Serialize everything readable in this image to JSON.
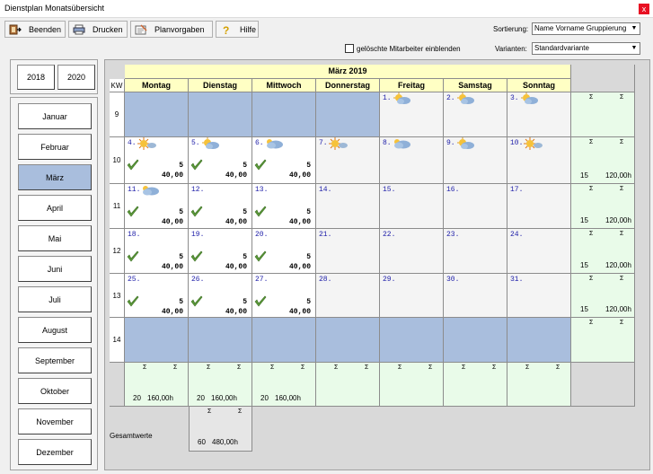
{
  "window": {
    "title": "Dienstplan Monatsübersicht",
    "close": "x"
  },
  "toolbar": [
    {
      "name": "beenden-button",
      "icon": "exit-icon",
      "label": "Beenden"
    },
    {
      "name": "drucken-button",
      "icon": "print-icon",
      "label": "Drucken"
    },
    {
      "name": "planvorgaben-button",
      "icon": "planvorgaben-icon",
      "label": "Planvorgaben"
    },
    {
      "name": "hilfe-button",
      "icon": "help-icon",
      "label": "Hilfe"
    }
  ],
  "sort": {
    "label": "Sortierung:",
    "value": "Name Vorname Gruppierung"
  },
  "variant": {
    "label": "Varianten:",
    "value": "Standardvariante"
  },
  "deleted_checkbox": {
    "label": "gelöschte Mitarbeiter einblenden",
    "checked": false
  },
  "years": [
    "2018",
    "2020"
  ],
  "months": [
    "Januar",
    "Februar",
    "März",
    "April",
    "Mai",
    "Juni",
    "Juli",
    "August",
    "September",
    "Oktober",
    "November",
    "Dezember"
  ],
  "selected_month": "März",
  "calendar": {
    "title": "März 2019",
    "kw_label": "KW",
    "days": [
      "Montag",
      "Dienstag",
      "Mittwoch",
      "Donnerstag",
      "Freitag",
      "Samstag",
      "Sonntag"
    ],
    "sigma": "Σ",
    "weeks": [
      {
        "kw": "9",
        "cells": [
          {
            "bg": "blue"
          },
          {
            "bg": "blue"
          },
          {
            "bg": "blue"
          },
          {
            "bg": "blue"
          },
          {
            "day": "1.",
            "weather": "sun-cloud",
            "bg": "grey"
          },
          {
            "day": "2.",
            "weather": "sun-cloud",
            "bg": "grey"
          },
          {
            "day": "3.",
            "weather": "sun-cloud",
            "bg": "grey"
          }
        ],
        "sum": {
          "count": "",
          "hours": ""
        }
      },
      {
        "kw": "10",
        "cells": [
          {
            "day": "4.",
            "weather": "sun",
            "check": true,
            "value": "5",
            "hours": "40,00",
            "bg": "white"
          },
          {
            "day": "5.",
            "weather": "sun-cloud",
            "check": true,
            "value": "5",
            "hours": "40,00",
            "bg": "white"
          },
          {
            "day": "6.",
            "weather": "cloud",
            "check": true,
            "value": "5",
            "hours": "40,00",
            "bg": "white"
          },
          {
            "day": "7.",
            "weather": "sun",
            "bg": "grey"
          },
          {
            "day": "8.",
            "weather": "cloud",
            "bg": "grey"
          },
          {
            "day": "9.",
            "weather": "sun-cloud",
            "bg": "grey"
          },
          {
            "day": "10.",
            "weather": "sun",
            "bg": "grey"
          }
        ],
        "sum": {
          "count": "15",
          "hours": "120,00h"
        }
      },
      {
        "kw": "11",
        "cells": [
          {
            "day": "11.",
            "weather": "cloud",
            "check": true,
            "value": "5",
            "hours": "40,00",
            "bg": "white"
          },
          {
            "day": "12.",
            "check": true,
            "value": "5",
            "hours": "40,00",
            "bg": "white"
          },
          {
            "day": "13.",
            "check": true,
            "value": "5",
            "hours": "40,00",
            "bg": "white"
          },
          {
            "day": "14.",
            "bg": "grey"
          },
          {
            "day": "15.",
            "bg": "grey"
          },
          {
            "day": "16.",
            "bg": "grey"
          },
          {
            "day": "17.",
            "bg": "grey"
          }
        ],
        "sum": {
          "count": "15",
          "hours": "120,00h"
        }
      },
      {
        "kw": "12",
        "cells": [
          {
            "day": "18.",
            "check": true,
            "value": "5",
            "hours": "40,00",
            "bg": "white"
          },
          {
            "day": "19.",
            "check": true,
            "value": "5",
            "hours": "40,00",
            "bg": "white"
          },
          {
            "day": "20.",
            "check": true,
            "value": "5",
            "hours": "40,00",
            "bg": "white"
          },
          {
            "day": "21.",
            "bg": "grey"
          },
          {
            "day": "22.",
            "bg": "grey"
          },
          {
            "day": "23.",
            "bg": "grey"
          },
          {
            "day": "24.",
            "bg": "grey"
          }
        ],
        "sum": {
          "count": "15",
          "hours": "120,00h"
        }
      },
      {
        "kw": "13",
        "cells": [
          {
            "day": "25.",
            "check": true,
            "value": "5",
            "hours": "40,00",
            "bg": "white"
          },
          {
            "day": "26.",
            "check": true,
            "value": "5",
            "hours": "40,00",
            "bg": "white"
          },
          {
            "day": "27.",
            "check": true,
            "value": "5",
            "hours": "40,00",
            "bg": "white"
          },
          {
            "day": "28.",
            "bg": "grey"
          },
          {
            "day": "29.",
            "bg": "grey"
          },
          {
            "day": "30.",
            "bg": "grey"
          },
          {
            "day": "31.",
            "bg": "grey"
          }
        ],
        "sum": {
          "count": "15",
          "hours": "120,00h"
        }
      },
      {
        "kw": "14",
        "cells": [
          {
            "bg": "blue"
          },
          {
            "bg": "blue"
          },
          {
            "bg": "blue"
          },
          {
            "bg": "blue"
          },
          {
            "bg": "blue"
          },
          {
            "bg": "blue"
          },
          {
            "bg": "blue"
          }
        ],
        "sum": {
          "count": "",
          "hours": ""
        }
      }
    ],
    "day_sums": [
      {
        "count": "20",
        "hours": "160,00h"
      },
      {
        "count": "20",
        "hours": "160,00h"
      },
      {
        "count": "20",
        "hours": "160,00h"
      },
      {
        "count": "",
        "hours": ""
      },
      {
        "count": "",
        "hours": ""
      },
      {
        "count": "",
        "hours": ""
      },
      {
        "count": "",
        "hours": ""
      }
    ],
    "total": {
      "label": "Gesamtwerte",
      "count": "60",
      "hours": "480,00h"
    }
  },
  "colors": {
    "header": "#ffffc4",
    "blocked": "#a9bedd",
    "sum": "#e9fbe9",
    "selected_month": "#a9bedd",
    "check": "#5c9a3a",
    "day_number": "#2222aa"
  }
}
